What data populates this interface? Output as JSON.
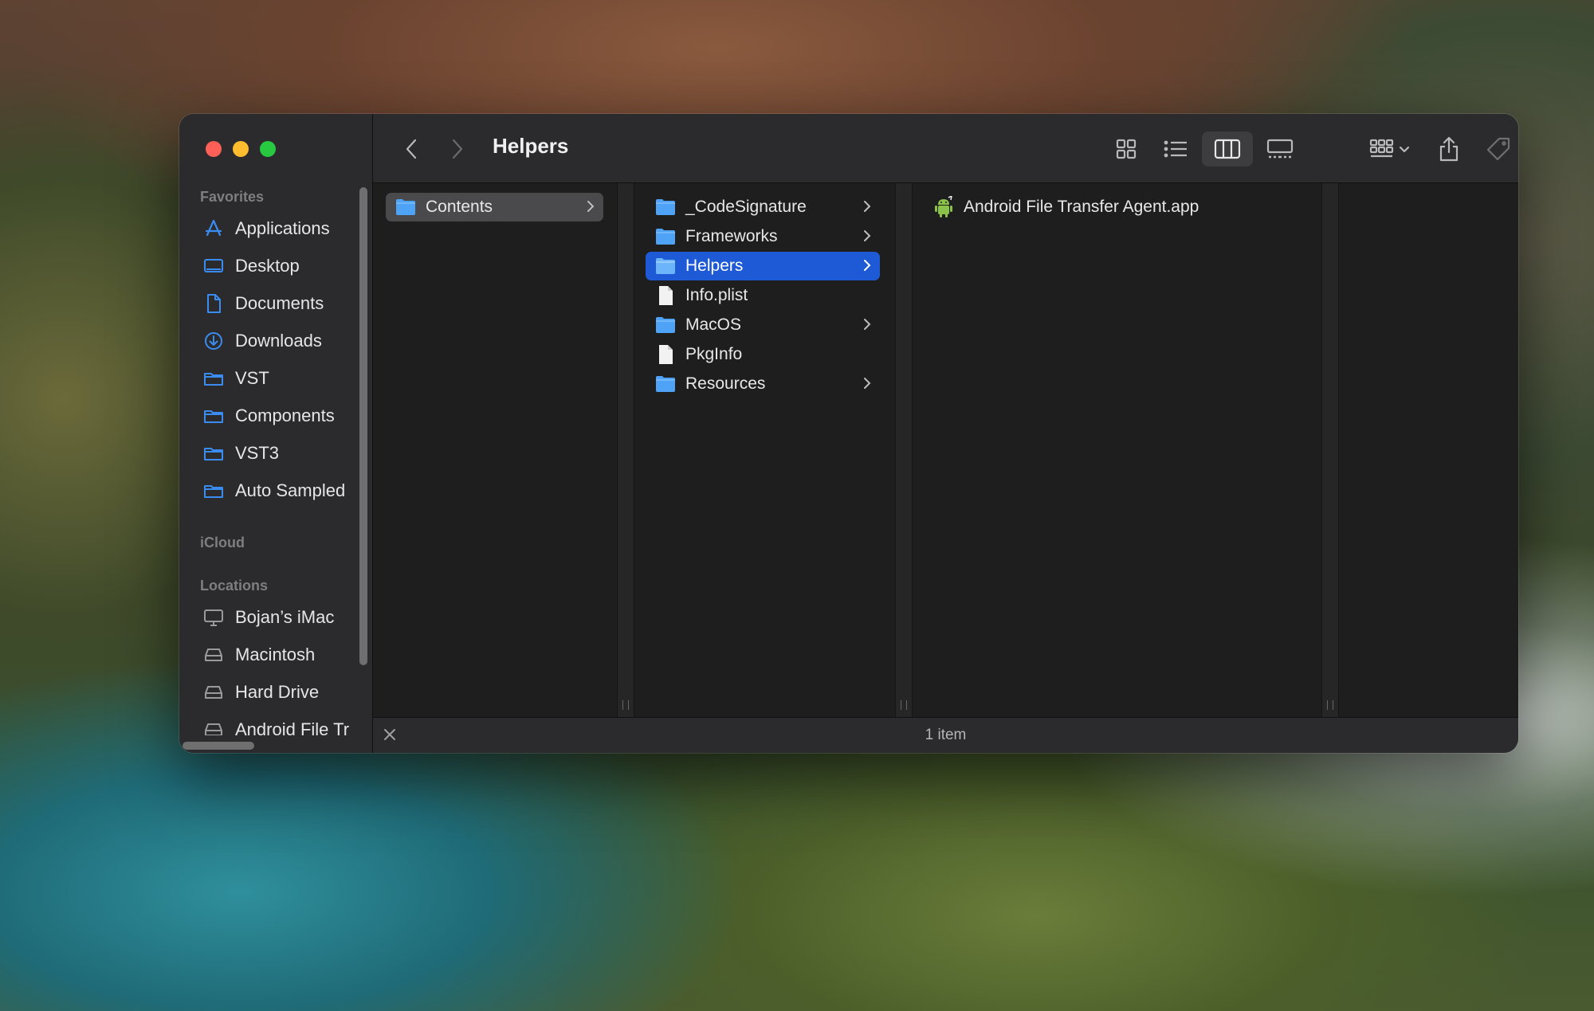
{
  "window": {
    "title": "Helpers"
  },
  "sidebar": {
    "favorites_header": "Favorites",
    "favorites": [
      {
        "label": "Applications",
        "icon": "applications-icon"
      },
      {
        "label": "Desktop",
        "icon": "desktop-icon"
      },
      {
        "label": "Documents",
        "icon": "documents-icon"
      },
      {
        "label": "Downloads",
        "icon": "downloads-icon"
      },
      {
        "label": "VST",
        "icon": "folder-icon"
      },
      {
        "label": "Components",
        "icon": "folder-icon"
      },
      {
        "label": "VST3",
        "icon": "folder-icon"
      },
      {
        "label": "Auto Sampled",
        "icon": "folder-icon"
      }
    ],
    "icloud_header": "iCloud",
    "locations_header": "Locations",
    "locations": [
      {
        "label": "Bojan’s iMac",
        "icon": "computer-icon"
      },
      {
        "label": "Macintosh",
        "icon": "drive-icon"
      },
      {
        "label": "Hard Drive",
        "icon": "drive-icon"
      },
      {
        "label": "Android File Tr",
        "icon": "drive-icon"
      }
    ]
  },
  "columns": {
    "col1": [
      {
        "label": "Contents",
        "type": "folder",
        "has_children": true,
        "selected": "inactive"
      }
    ],
    "col2": [
      {
        "label": "_CodeSignature",
        "type": "folder",
        "has_children": true
      },
      {
        "label": "Frameworks",
        "type": "folder",
        "has_children": true
      },
      {
        "label": "Helpers",
        "type": "folder",
        "has_children": true,
        "selected": "active"
      },
      {
        "label": "Info.plist",
        "type": "document",
        "has_children": false
      },
      {
        "label": "MacOS",
        "type": "folder",
        "has_children": true
      },
      {
        "label": "PkgInfo",
        "type": "document",
        "has_children": false
      },
      {
        "label": "Resources",
        "type": "folder",
        "has_children": true
      }
    ],
    "col3": [
      {
        "label": "Android File Transfer Agent.app",
        "type": "app",
        "has_children": false
      }
    ]
  },
  "status": {
    "text": "1 item"
  },
  "colors": {
    "accent": "#1f5ad6",
    "folder": "#4fa3f7",
    "sidebar_icon": "#3b8cf0"
  }
}
